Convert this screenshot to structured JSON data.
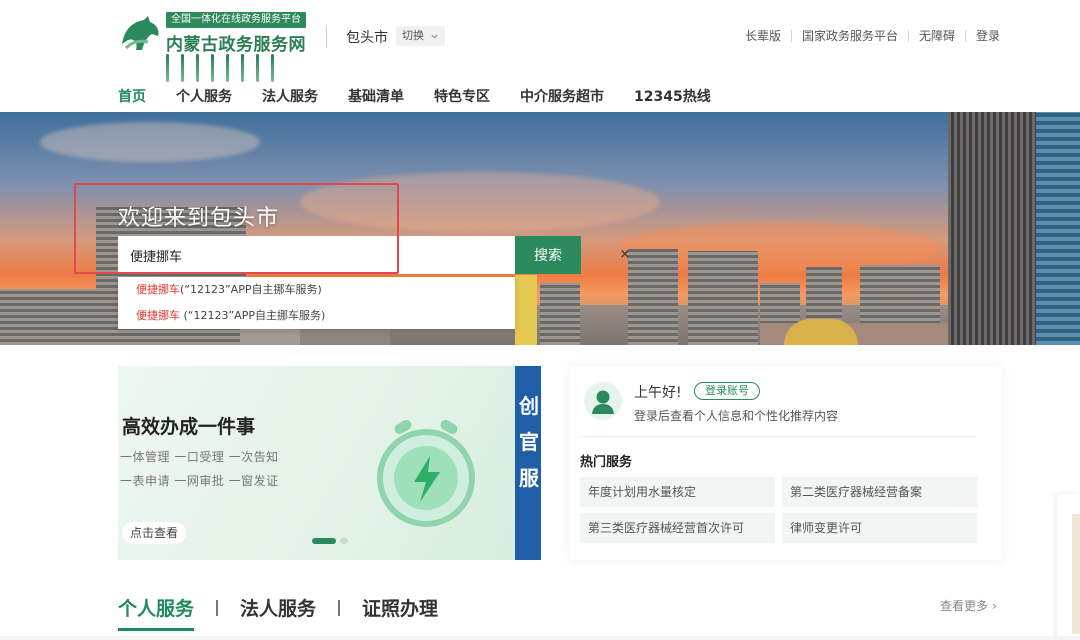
{
  "header": {
    "logo_badge": "全国一体化在线政务服务平台",
    "logo_name": "内蒙古政务服务网",
    "city": "包头市",
    "switch_label": "切换",
    "links": [
      "长辈版",
      "国家政务服务平台",
      "无障碍",
      "登录"
    ]
  },
  "nav": [
    "首页",
    "个人服务",
    "法人服务",
    "基础清单",
    "特色专区",
    "中介服务超市",
    "12345热线"
  ],
  "banner": {
    "welcome": "欢迎来到包头市",
    "search_value": "便捷挪车",
    "clear_icon": "×",
    "search_button": "搜索",
    "suggestions": [
      {
        "highlight": "便捷挪车",
        "rest": "(“12123”APP自主挪车服务)"
      },
      {
        "highlight": "便捷挪车",
        "rest": " (“12123”APP自主挪车服务)"
      }
    ]
  },
  "promo": {
    "title": "高效办成一件事",
    "line1": "一体管理 一口受理 一次告知",
    "line2": "一表申请 一网审批 一窗发证",
    "button": "点击查看",
    "strip_text": "创官服"
  },
  "user_card": {
    "greeting": "上午好!",
    "login_tag": "登录账号",
    "login_tip": "登录后查看个人信息和个性化推荐内容",
    "hot_title": "热门服务",
    "services": [
      "年度计划用水量核定",
      "第二类医疗器械经营备案",
      "第三类医疗器械经营首次许可",
      "律师变更许可"
    ]
  },
  "tabs": {
    "items": [
      "个人服务",
      "法人服务",
      "证照办理"
    ],
    "more": "查看更多",
    "more_chevron": "›"
  },
  "colors": {
    "brand_green": "#2a8a5c",
    "highlight_red": "#e0342f",
    "strip_blue": "#1e5fa8",
    "annotation_red": "#e04a4f"
  }
}
